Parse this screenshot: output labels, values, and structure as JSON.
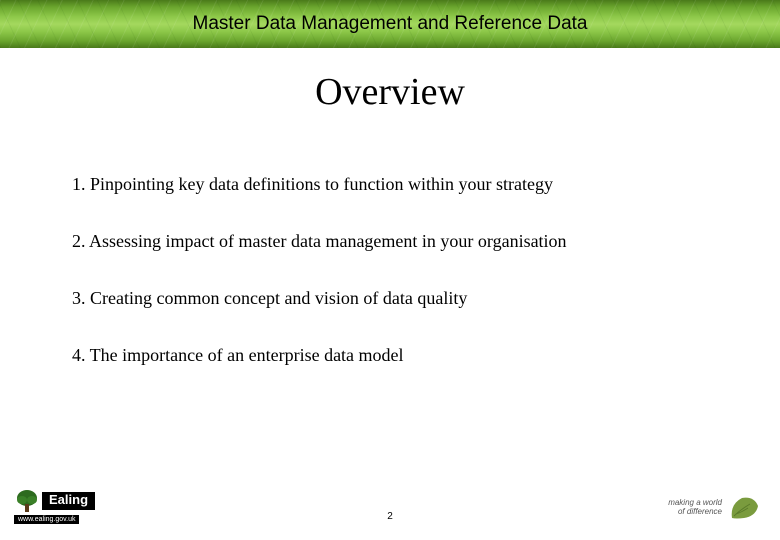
{
  "header": {
    "title": "Master Data Management and Reference Data"
  },
  "main": {
    "title": "Overview",
    "items": [
      "1. Pinpointing key data definitions to function within your strategy",
      "2. Assessing impact of master data management in your organisation",
      "3. Creating common concept and vision of data quality",
      "4. The importance of an enterprise data model"
    ]
  },
  "footer": {
    "page_number": "2",
    "left_logo": {
      "name": "Ealing",
      "url": "www.ealing.gov.uk"
    },
    "right_logo": {
      "tagline_line1": "making a world",
      "tagline_line2": "of difference"
    }
  }
}
